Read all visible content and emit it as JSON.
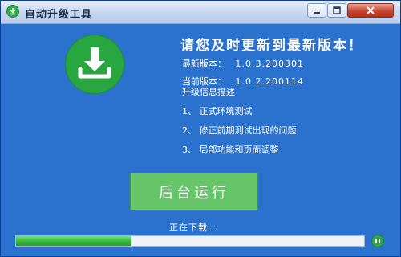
{
  "window": {
    "title": "自动升级工具"
  },
  "update": {
    "headline": "请您及时更新到最新版本！",
    "latest_label": "最新版本：",
    "latest_version": "1.0.3.200301",
    "current_label": "当前版本：",
    "current_version": "1.0.2.200114",
    "desc_title": "升级信息描述",
    "items": [
      "1、 正式环境测试",
      "2、 修正前期测试出现的问题",
      "3、 局部功能和页面调整"
    ]
  },
  "actions": {
    "background_run_label": "后台运行"
  },
  "download": {
    "status_text": "正在下载...",
    "progress_fraction": 0.33
  },
  "icons": {
    "app": "download-icon",
    "badge": "download-arrow-icon",
    "pause": "pause-icon"
  },
  "colors": {
    "background": "#2b72ce",
    "accent_green": "#29a63f",
    "button_green": "#67c569"
  }
}
